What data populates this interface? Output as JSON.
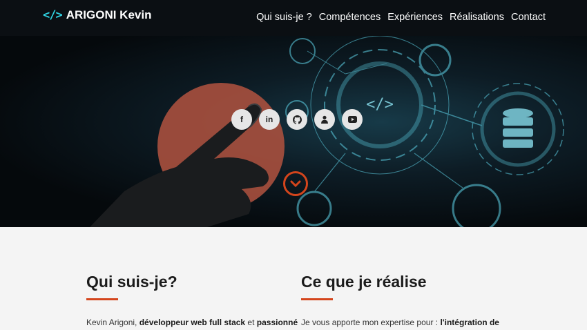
{
  "brand": {
    "icon": "</>",
    "name": "ARIGONI Kevin"
  },
  "nav": {
    "items": [
      "Qui suis-je ?",
      "Compétences",
      "Expériences",
      "Réalisations",
      "Contact"
    ]
  },
  "hero": {
    "socials": [
      {
        "icon": "facebook-icon",
        "glyph": "f"
      },
      {
        "icon": "linkedin-icon",
        "glyph": "in"
      },
      {
        "icon": "github-icon",
        "glyph": ""
      },
      {
        "icon": "user-icon",
        "glyph": ""
      },
      {
        "icon": "youtube-icon",
        "glyph": ""
      }
    ],
    "accent": "#d4451c"
  },
  "about": {
    "title": "Qui suis-je?",
    "intro_plain1": "Kevin Arigoni, ",
    "intro_bold1": "développeur web full stack",
    "intro_plain2": " et ",
    "intro_bold2": "passionné"
  },
  "work": {
    "title": "Ce que je réalise",
    "intro_plain": "Je vous apporte mon expertise pour : ",
    "intro_bold": "l'intégration de"
  }
}
